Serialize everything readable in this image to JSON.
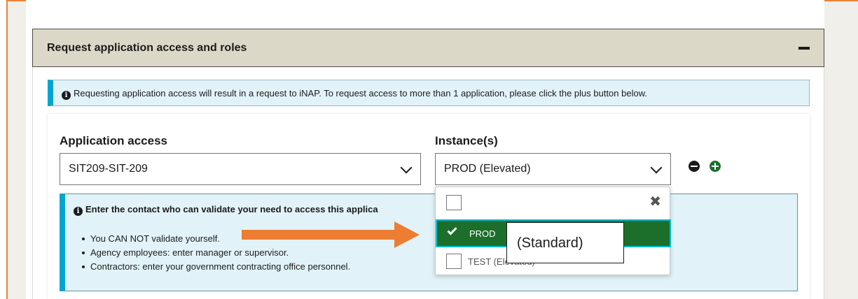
{
  "panel": {
    "title": "Request application access and roles",
    "collapse_icon": "minus-icon"
  },
  "info_alert": {
    "text": "Requesting application access will result in a request to iNAP. To request access to more than 1 application, please click the plus button below."
  },
  "application_access": {
    "label": "Application access",
    "value": "SIT209-SIT-209"
  },
  "instances": {
    "label": "Instance(s)",
    "value": "PROD (Elevated)"
  },
  "contact_alert": {
    "title": "Enter the contact who can validate your need to access this applica",
    "items": [
      "You CAN NOT validate yourself.",
      "Agency employees: enter manager or supervisor.",
      "Contractors: enter your government contracting office personnel."
    ]
  },
  "dropdown": {
    "options": [
      {
        "label": "PROD",
        "selected": true
      },
      {
        "label": "TEST (Elevated)",
        "selected": false
      }
    ]
  },
  "annotation": {
    "text": "(Standard)"
  },
  "colors": {
    "accent_green": "#1b6f2a",
    "info_blue": "#00a6d2",
    "arrow_orange": "#ed7d31",
    "header_beige": "#dcd8c8"
  }
}
